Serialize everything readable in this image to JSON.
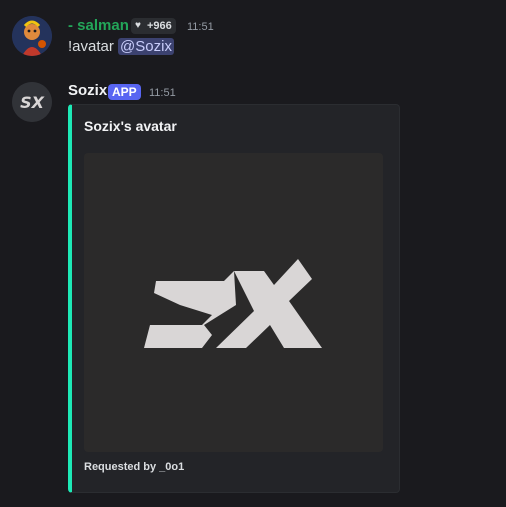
{
  "messages": [
    {
      "username": "- salman",
      "username_color": "#23a559",
      "badge": {
        "icon": "heart-icon",
        "text": "+966"
      },
      "time": "11:51",
      "command": "!avatar",
      "mention": "@Sozix"
    },
    {
      "username": "Sozix",
      "username_color": "#f2f3f5",
      "app_tag": "APP",
      "app_tag_color": "#5865f2",
      "time": "11:51",
      "embed": {
        "accent_color": "#1de9b6",
        "title": "Sozix's avatar",
        "image_logo": "SX",
        "footer": "Requested by _0o1"
      }
    }
  ]
}
